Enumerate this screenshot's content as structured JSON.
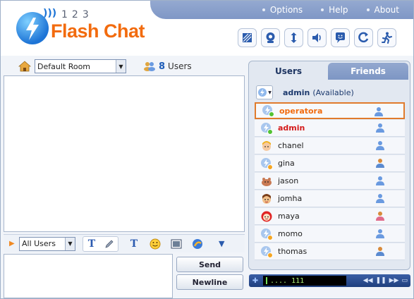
{
  "nav": {
    "options": "Options",
    "help": "Help",
    "about": "About"
  },
  "logo": {
    "numbers": "123",
    "name": "Flash Chat"
  },
  "toolbar_icons": [
    "clear-icon",
    "webcam-icon",
    "sort-icon",
    "sound-icon",
    "smiley-bubble-icon",
    "refresh-icon",
    "exit-icon"
  ],
  "room": {
    "selected": "Default Room",
    "user_count": "8",
    "users_label": "Users"
  },
  "input": {
    "recipient": "All Users",
    "send_label": "Send",
    "newline_label": "Newline"
  },
  "tabs": {
    "users": "Users",
    "friends": "Friends"
  },
  "me": {
    "name": "admin",
    "status": "(Available)"
  },
  "users": [
    {
      "name": "operatora",
      "gender": "male",
      "avatar": "globe",
      "selected": true
    },
    {
      "name": "admin",
      "gender": "male",
      "avatar": "globe"
    },
    {
      "name": "chanel",
      "gender": "male",
      "avatar": "blonde-face"
    },
    {
      "name": "gina",
      "gender": "female",
      "avatar": "globe"
    },
    {
      "name": "jason",
      "gender": "male",
      "avatar": "critter"
    },
    {
      "name": "jomha",
      "gender": "male",
      "avatar": "dark-face"
    },
    {
      "name": "maya",
      "gender": "female",
      "avatar": "red-face"
    },
    {
      "name": "momo",
      "gender": "male",
      "avatar": "globe"
    },
    {
      "name": "thomas",
      "gender": "female",
      "avatar": "globe"
    }
  ],
  "player": {
    "display": ".... 111"
  },
  "colors": {
    "accent_orange": "#f26b0e",
    "admin_red": "#d41a1a",
    "nav_blue": "#7f97c6",
    "selection_border": "#e07b2c"
  }
}
